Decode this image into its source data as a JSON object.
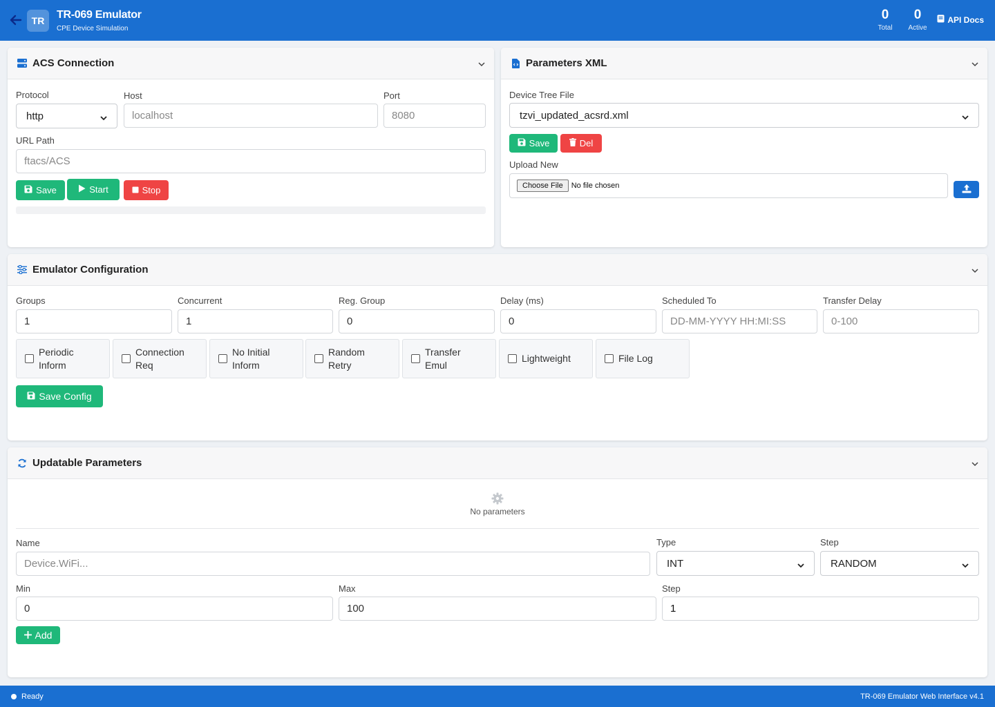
{
  "header": {
    "logo": "TR",
    "title": "TR-069 Emulator",
    "subtitle": "CPE Device Simulation",
    "total_value": "0",
    "total_label": "Total",
    "active_value": "0",
    "active_label": "Active",
    "api_docs": "API Docs"
  },
  "acs": {
    "title": "ACS Connection",
    "protocol_label": "Protocol",
    "protocol_value": "http",
    "host_label": "Host",
    "host_placeholder": "localhost",
    "port_label": "Port",
    "port_placeholder": "8080",
    "url_label": "URL Path",
    "url_placeholder": "ftacs/ACS",
    "save": "Save",
    "start": "Start",
    "stop": "Stop"
  },
  "xml": {
    "title": "Parameters XML",
    "tree_label": "Device Tree File",
    "tree_value": "tzvi_updated_acsrd.xml",
    "save": "Save",
    "del": "Del",
    "upload_label": "Upload New",
    "choose_file": "Choose File",
    "no_file": "No file chosen"
  },
  "config": {
    "title": "Emulator Configuration",
    "fields": [
      {
        "label": "Groups",
        "value": "1"
      },
      {
        "label": "Concurrent",
        "value": "1"
      },
      {
        "label": "Reg. Group",
        "value": "0"
      },
      {
        "label": "Delay (ms)",
        "value": "0"
      },
      {
        "label": "Scheduled To",
        "value": "DD-MM-YYYY HH:MI:SS"
      },
      {
        "label": "Transfer Delay",
        "value": "0-100"
      }
    ],
    "checks": [
      {
        "l1": "Periodic",
        "l2": "Inform"
      },
      {
        "l1": "Connection",
        "l2": "Req"
      },
      {
        "l1": "No Initial",
        "l2": "Inform"
      },
      {
        "l1": "Random",
        "l2": "Retry"
      },
      {
        "l1": "Transfer",
        "l2": "Emul"
      },
      {
        "l1": "Lightweight",
        "l2": ""
      },
      {
        "l1": "File Log",
        "l2": ""
      }
    ],
    "save": "Save Config"
  },
  "params": {
    "title": "Updatable Parameters",
    "empty": "No parameters",
    "name_label": "Name",
    "name_placeholder": "Device.WiFi...",
    "type_label": "Type",
    "type_value": "INT",
    "step_label": "Step",
    "step_value": "RANDOM",
    "min_label": "Min",
    "min_value": "0",
    "max_label": "Max",
    "max_value": "100",
    "step2_label": "Step",
    "step2_value": "1",
    "add": "Add"
  },
  "footer": {
    "status": "Ready",
    "version": "TR-069 Emulator Web Interface v4.1"
  }
}
